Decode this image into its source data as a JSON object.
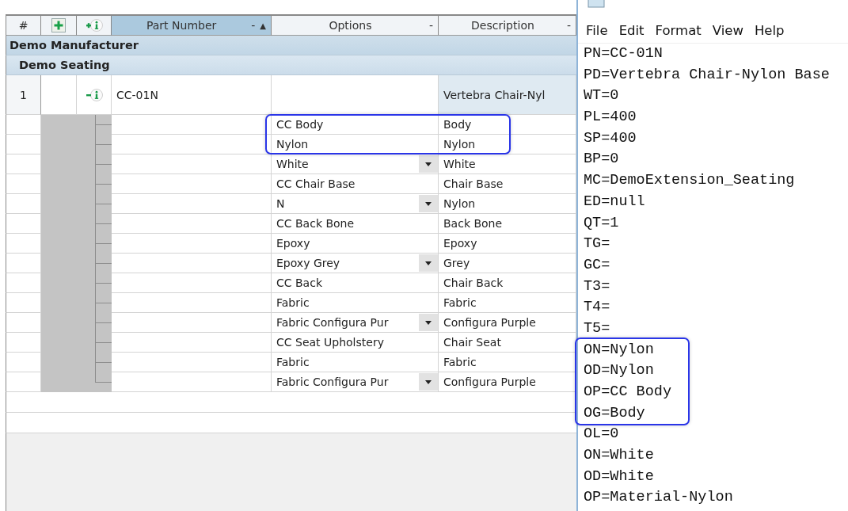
{
  "grid": {
    "number_label": "#",
    "columns": [
      {
        "label": "Part Number",
        "menu": "-",
        "sort": "▲",
        "selected": true
      },
      {
        "label": "Options",
        "menu": "-",
        "selected": false
      },
      {
        "label": "Description",
        "menu": "-",
        "selected": false
      }
    ],
    "groups": [
      {
        "name": "Demo Manufacturer",
        "children": [
          {
            "name": "Demo Seating",
            "items": [
              {
                "number": "1",
                "part_number": "CC-01N",
                "description": "Vertebra Chair-Nyl",
                "expanded": true,
                "options": [
                  {
                    "option": "CC Body",
                    "description": "Body",
                    "dropdown": false,
                    "highlighted": true
                  },
                  {
                    "option": "Nylon",
                    "description": "Nylon",
                    "dropdown": false,
                    "highlighted": true
                  },
                  {
                    "option": "White",
                    "description": "White",
                    "dropdown": true,
                    "highlighted": false
                  },
                  {
                    "option": "CC Chair Base",
                    "description": "Chair Base",
                    "dropdown": false,
                    "highlighted": false
                  },
                  {
                    "option": "N",
                    "description": "Nylon",
                    "dropdown": true,
                    "highlighted": false
                  },
                  {
                    "option": "CC Back Bone",
                    "description": "Back Bone",
                    "dropdown": false,
                    "highlighted": false
                  },
                  {
                    "option": "Epoxy",
                    "description": "Epoxy",
                    "dropdown": false,
                    "highlighted": false
                  },
                  {
                    "option": "Epoxy Grey",
                    "description": "Grey",
                    "dropdown": true,
                    "highlighted": false
                  },
                  {
                    "option": "CC Back",
                    "description": "Chair Back",
                    "dropdown": false,
                    "highlighted": false
                  },
                  {
                    "option": "Fabric",
                    "description": "Fabric",
                    "dropdown": false,
                    "highlighted": false
                  },
                  {
                    "option": "Fabric Configura Pur",
                    "description": "Configura Purple",
                    "dropdown": true,
                    "highlighted": false
                  },
                  {
                    "option": "CC Seat Upholstery",
                    "description": "Chair Seat",
                    "dropdown": false,
                    "highlighted": false
                  },
                  {
                    "option": "Fabric",
                    "description": "Fabric",
                    "dropdown": false,
                    "highlighted": false
                  },
                  {
                    "option": "Fabric Configura Pur",
                    "description": "Configura Purple",
                    "dropdown": true,
                    "highlighted": false
                  }
                ]
              }
            ]
          }
        ]
      }
    ]
  },
  "notepad": {
    "menu": [
      "File",
      "Edit",
      "Format",
      "View",
      "Help"
    ],
    "lines": [
      {
        "text": "PN=CC-01N",
        "highlighted": false
      },
      {
        "text": "PD=Vertebra Chair-Nylon Base",
        "highlighted": false
      },
      {
        "text": "WT=0",
        "highlighted": false
      },
      {
        "text": "PL=400",
        "highlighted": false
      },
      {
        "text": "SP=400",
        "highlighted": false
      },
      {
        "text": "BP=0",
        "highlighted": false
      },
      {
        "text": "MC=DemoExtension_Seating",
        "highlighted": false
      },
      {
        "text": "ED=null",
        "highlighted": false
      },
      {
        "text": "QT=1",
        "highlighted": false
      },
      {
        "text": "TG=",
        "highlighted": false
      },
      {
        "text": "GC=",
        "highlighted": false
      },
      {
        "text": "T3=",
        "highlighted": false
      },
      {
        "text": "T4=",
        "highlighted": false
      },
      {
        "text": "T5=",
        "highlighted": false
      },
      {
        "text": "ON=Nylon",
        "highlighted": true
      },
      {
        "text": "OD=Nylon",
        "highlighted": true
      },
      {
        "text": "OP=CC Body",
        "highlighted": true
      },
      {
        "text": "OG=Body",
        "highlighted": true
      },
      {
        "text": "OL=0",
        "highlighted": false
      },
      {
        "text": "ON=White",
        "highlighted": false
      },
      {
        "text": "OD=White",
        "highlighted": false
      },
      {
        "text": "OP=Material-Nylon",
        "highlighted": false
      }
    ]
  }
}
